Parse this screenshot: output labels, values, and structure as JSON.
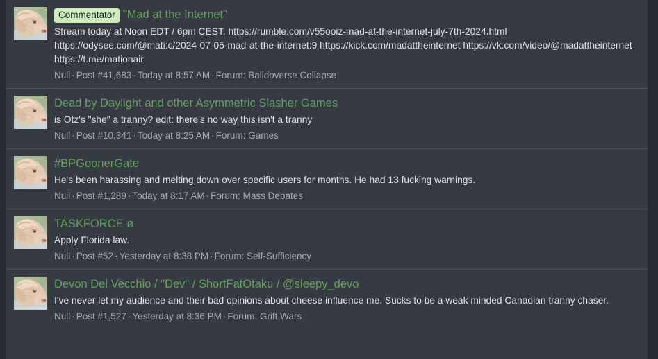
{
  "theme": {
    "page_background": "#282b31",
    "panel_background": "#363a42",
    "divider": "#4a4e57",
    "title_link": "#63a05f",
    "body_text": "#dfe1e4",
    "meta_text": "#a6a9ad",
    "badge_background": "#cdeebb",
    "badge_text": "#1d2021"
  },
  "separators": {
    "dot": "·",
    "forum_prefix": "Forum: "
  },
  "posts": [
    {
      "badge": "Commentator",
      "title": "\"Mad at the Internet\"",
      "snippet": "Stream today at Noon EDT / 6pm CEST. https://rumble.com/v55ooiz-mad-at-the-internet-july-7th-2024.html https://odysee.com/@mati:c/2024-07-05-mad-at-the-internet:9 https://kick.com/madattheinternet https://vk.com/video/@madattheinternet https://t.me/mationair",
      "author": "Null",
      "post_number": "Post #41,683",
      "timestamp": "Today at 8:57 AM",
      "forum": "Balldoverse Collapse",
      "avatar": "dog-avatar"
    },
    {
      "badge": "",
      "title": "Dead by Daylight and other Asymmetric Slasher Games",
      "snippet": "is Otz's \"she\" a tranny? edit: there's no way this isn't a tranny",
      "author": "Null",
      "post_number": "Post #10,341",
      "timestamp": "Today at 8:25 AM",
      "forum": "Games",
      "avatar": "dog-avatar"
    },
    {
      "badge": "",
      "title": "#BPGoonerGate",
      "snippet": "He's been harassing and melting down over specific users for months. He had 13 fucking warnings.",
      "author": "Null",
      "post_number": "Post #1,289",
      "timestamp": "Today at 8:17 AM",
      "forum": "Mass Debates",
      "avatar": "dog-avatar"
    },
    {
      "badge": "",
      "title": "TASKFORCE ø",
      "snippet": "Apply Florida law.",
      "author": "Null",
      "post_number": "Post #52",
      "timestamp": "Yesterday at 8:38 PM",
      "forum": "Self-Sufficiency",
      "avatar": "dog-avatar"
    },
    {
      "badge": "",
      "title": "Devon Del Vecchio / \"Dev\" / ShortFatOtaku / @sleepy_devo",
      "snippet": "I've never let my audience and their bad opinions about cheese influence me. Sucks to be a weak minded Canadian tranny chaser.",
      "author": "Null",
      "post_number": "Post #1,527",
      "timestamp": "Yesterday at 8:36 PM",
      "forum": "Grift Wars",
      "avatar": "dog-avatar"
    }
  ]
}
